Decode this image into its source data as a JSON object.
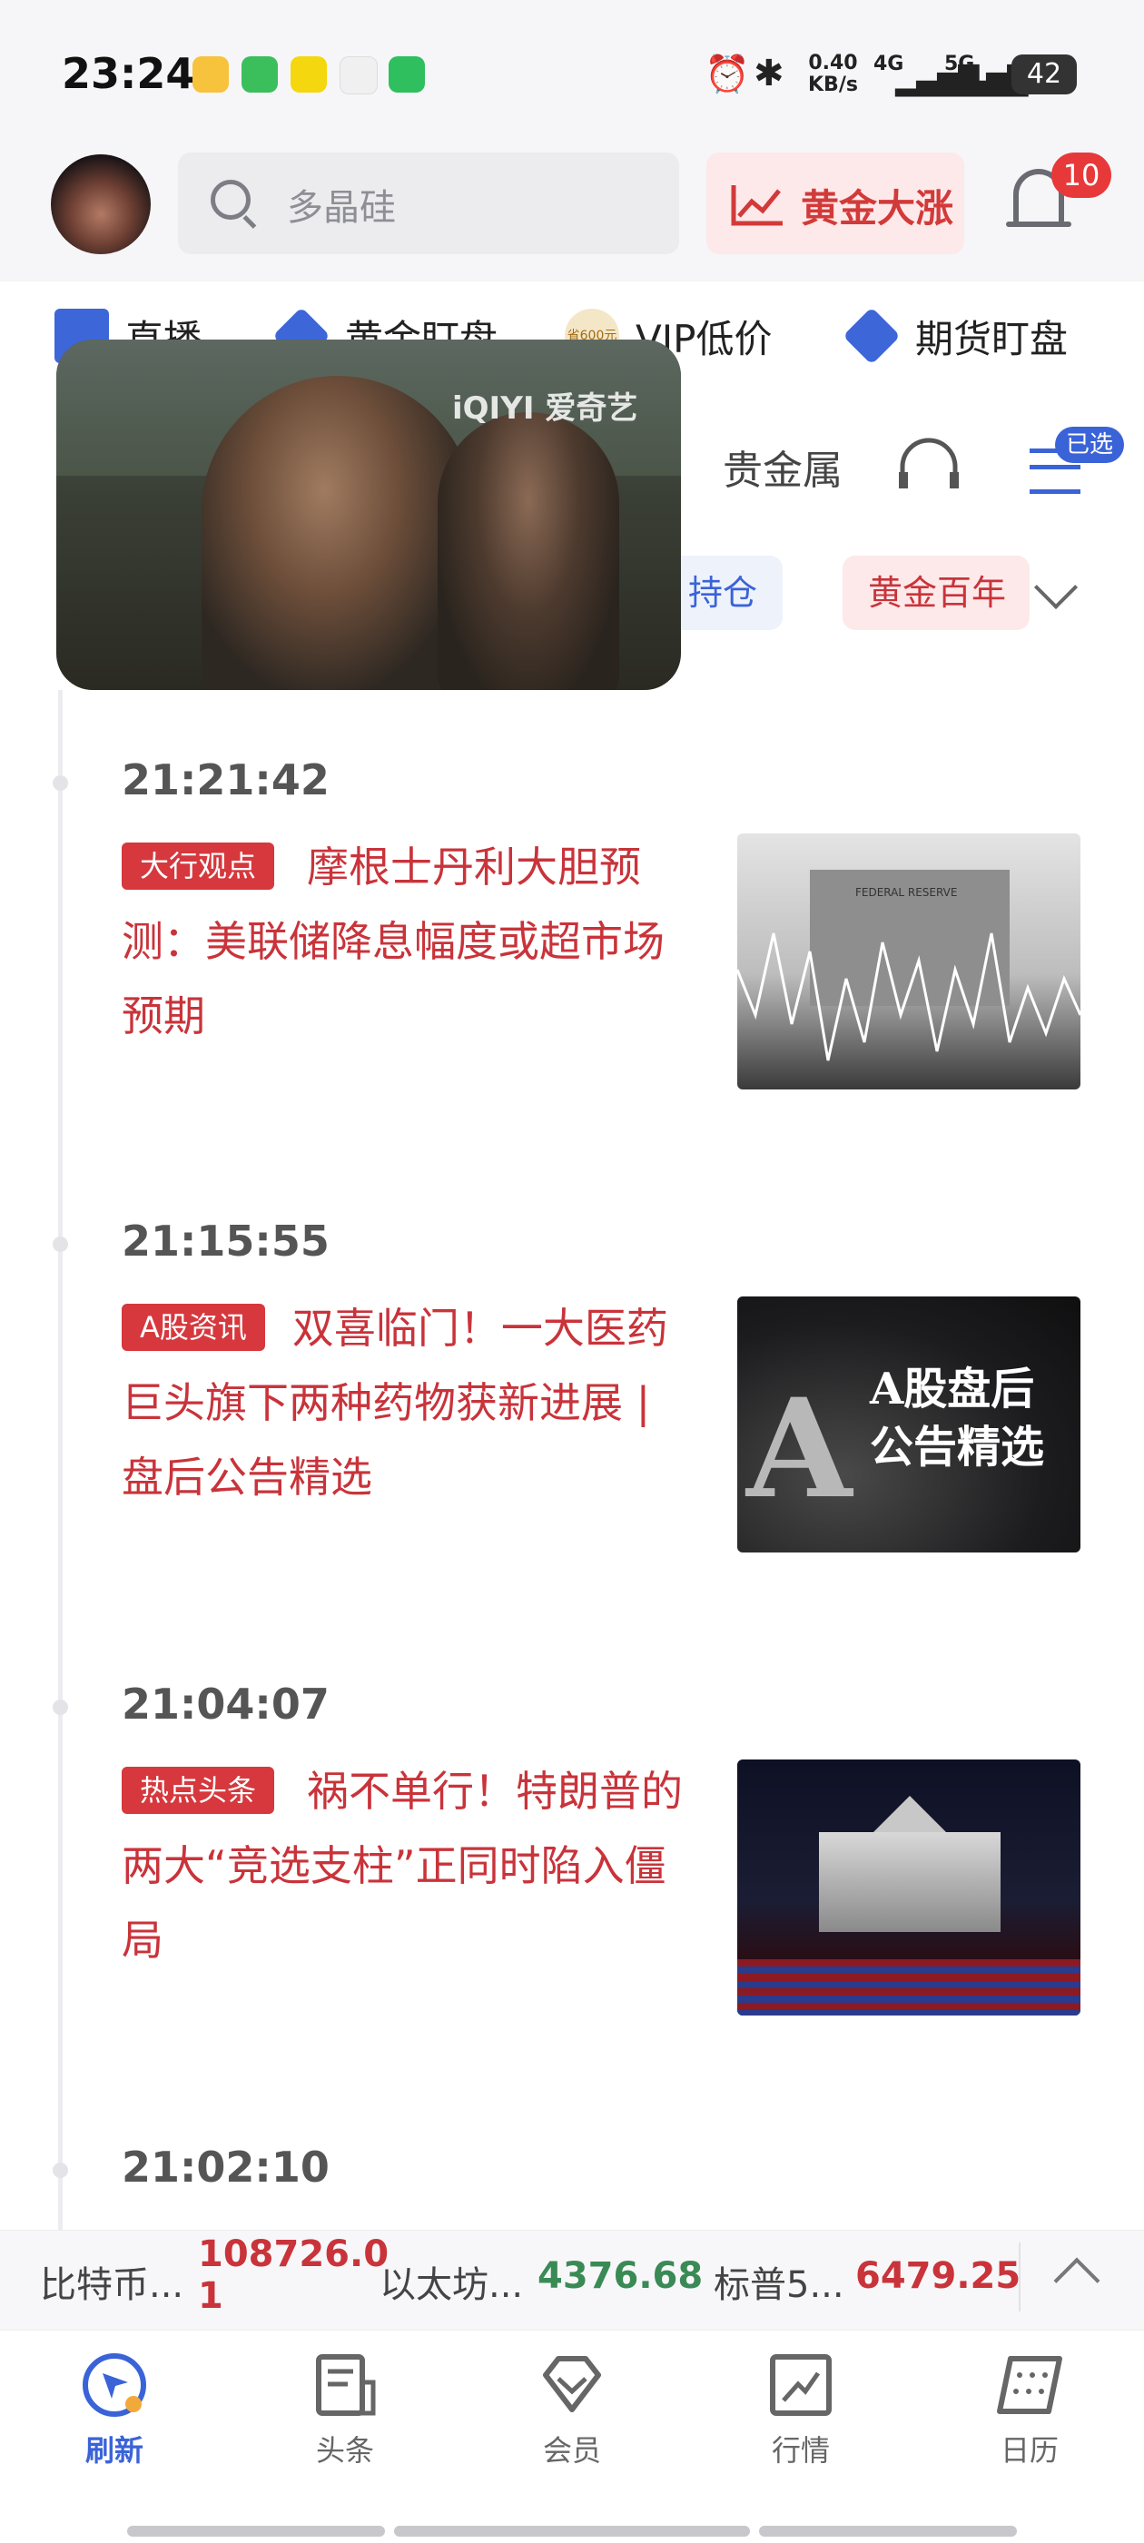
{
  "status_bar": {
    "time": "23:24",
    "net_speed": "0.40\nKB/s",
    "net_speed_value": "0.40",
    "net_speed_unit": "KB/s",
    "signal1": "4G",
    "signal2": "5G",
    "battery": "42"
  },
  "header": {
    "search_placeholder": "多晶硅",
    "hot_label": "黄金大涨",
    "notification_count": "10"
  },
  "shortcuts": [
    {
      "label": "直播"
    },
    {
      "label": "黄金盯盘"
    },
    {
      "label": "VIP低价",
      "badge": "省600元"
    },
    {
      "label": "期货盯盘"
    }
  ],
  "tabs": {
    "visible_tab": "贵金属",
    "selected_badge": "已选"
  },
  "chips": [
    {
      "label": "持仓"
    },
    {
      "label": "黄金百年"
    }
  ],
  "video": {
    "logo": "iQIYI 爱奇艺"
  },
  "news": [
    {
      "time": "21:21:42",
      "tag": "大行观点",
      "title": "摩根士丹利大胆预测：美联储降息幅度或超市场预期",
      "thumb_text": "FEDERAL RESERVE"
    },
    {
      "time": "21:15:55",
      "tag": "A股资讯",
      "title": "双喜临门！一大医药巨头旗下两种药物获新进展 | 盘后公告精选",
      "thumb_text": "A股盘后\n公告精选",
      "thumb_line1": "A股盘后",
      "thumb_line2": "公告精选"
    },
    {
      "time": "21:04:07",
      "tag": "热点头条",
      "title": "祸不单行！特朗普的两大“竞选支柱”正同时陷入僵局"
    },
    {
      "time": "21:02:10"
    }
  ],
  "ticker": [
    {
      "name": "比特币...",
      "value": "108726.01",
      "value_line1": "108726.0",
      "value_line2": "1",
      "color": "#c9333a"
    },
    {
      "name": "以太坊...",
      "value": "4376.68",
      "color": "#3a8a55"
    },
    {
      "name": "标普5...",
      "value": "6479.25",
      "color": "#c9333a"
    }
  ],
  "bottom_nav": [
    {
      "label": "刷新",
      "active": true
    },
    {
      "label": "头条"
    },
    {
      "label": "会员"
    },
    {
      "label": "行情"
    },
    {
      "label": "日历"
    }
  ],
  "colors": {
    "accent": "#3a63d8",
    "red": "#c9333a",
    "green": "#3a8a55"
  }
}
